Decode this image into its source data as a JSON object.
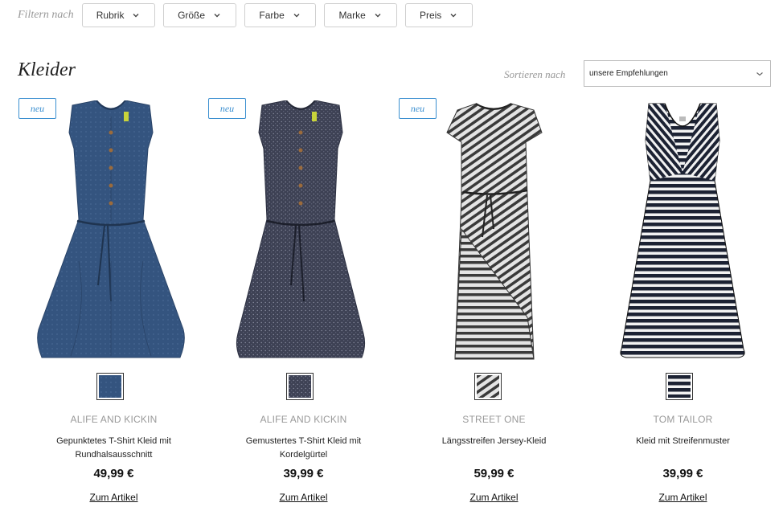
{
  "filters": {
    "label": "Filtern nach",
    "buttons": [
      {
        "label": "Rubrik"
      },
      {
        "label": "Größe"
      },
      {
        "label": "Farbe"
      },
      {
        "label": "Marke"
      },
      {
        "label": "Preis"
      }
    ]
  },
  "page": {
    "title": "Kleider"
  },
  "sort": {
    "label": "Sortieren nach",
    "selected": "unsere Empfehlungen"
  },
  "products": [
    {
      "badge": "neu",
      "brand": "ALIFE AND KICKIN",
      "name_line1": "Gepunktetes T-Shirt Kleid mit",
      "name_line2": "Rundhalsausschnitt",
      "price": "49,99 €",
      "link": "Zum Artikel",
      "color": "#34547f"
    },
    {
      "badge": "neu",
      "brand": "ALIFE AND KICKIN",
      "name_line1": "Gemustertes T-Shirt Kleid mit",
      "name_line2": "Kordelgürtel",
      "price": "39,99 €",
      "link": "Zum Artikel",
      "color": "#3d4154"
    },
    {
      "badge": "neu",
      "brand": "STREET ONE",
      "name_line1": "Längsstreifen Jersey-Kleid",
      "name_line2": "",
      "price": "59,99 €",
      "link": "Zum Artikel",
      "color": "#555555"
    },
    {
      "badge": "",
      "brand": "TOM TAILOR",
      "name_line1": "Kleid mit Streifenmuster",
      "name_line2": "",
      "price": "39,99 €",
      "link": "Zum Artikel",
      "color": "#1c2233"
    }
  ]
}
